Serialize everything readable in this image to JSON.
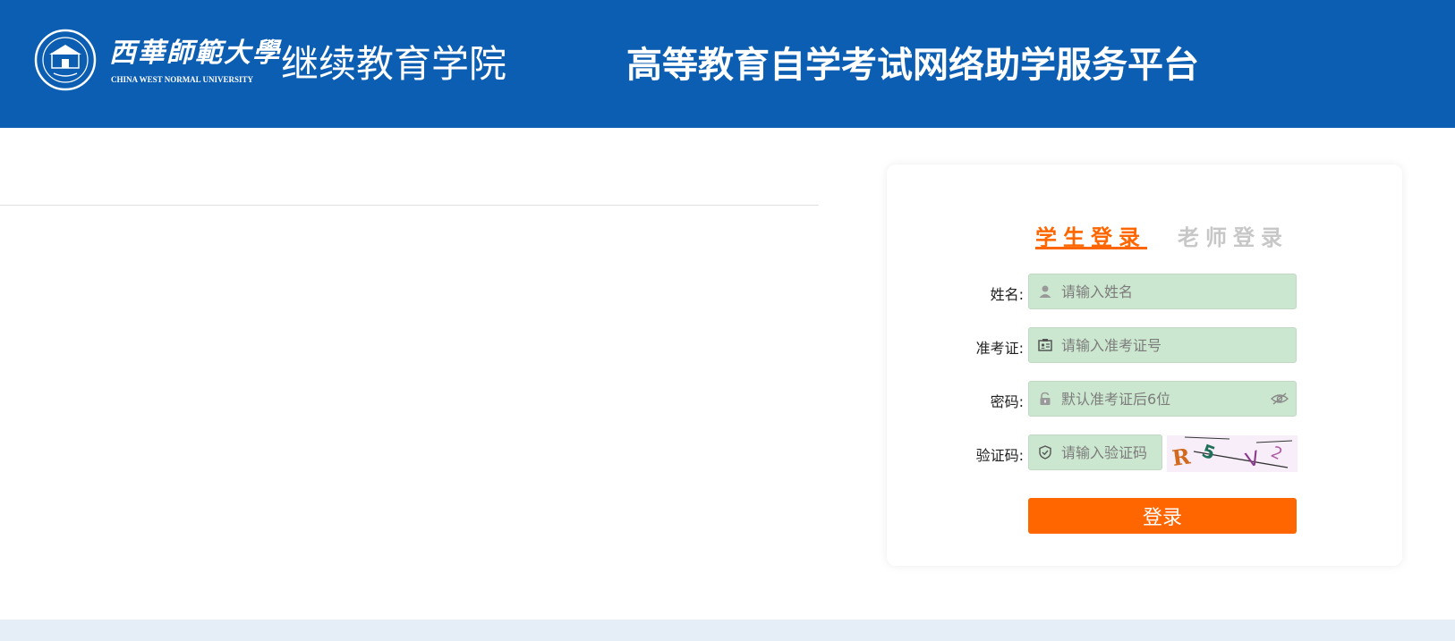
{
  "header": {
    "logo_cn": "西華師範大學",
    "logo_en": "CHINA WEST NORMAL UNIVERSITY",
    "college": "继续教育学院",
    "platform_title": "高等教育自学考试网络助学服务平台",
    "color": "#0c5eb2"
  },
  "login": {
    "tabs": [
      {
        "label": "学生登录",
        "active": true
      },
      {
        "label": "老师登录",
        "active": false
      }
    ],
    "fields": {
      "name": {
        "label": "姓名:",
        "placeholder": "请输入姓名",
        "icon": "user-icon"
      },
      "exam_id": {
        "label": "准考证:",
        "placeholder": "请输入准考证号",
        "icon": "id-card-icon"
      },
      "password": {
        "label": "密码:",
        "placeholder": "默认准考证后6位",
        "icon": "lock-icon",
        "toggle_icon": "eye-icon"
      },
      "captcha": {
        "label": "验证码:",
        "placeholder": "请输入验证码",
        "icon": "shield-icon",
        "image_text": "R5V2"
      }
    },
    "submit_label": "登录",
    "accent_color": "#ff6600",
    "field_bg": "#cce7cf"
  }
}
